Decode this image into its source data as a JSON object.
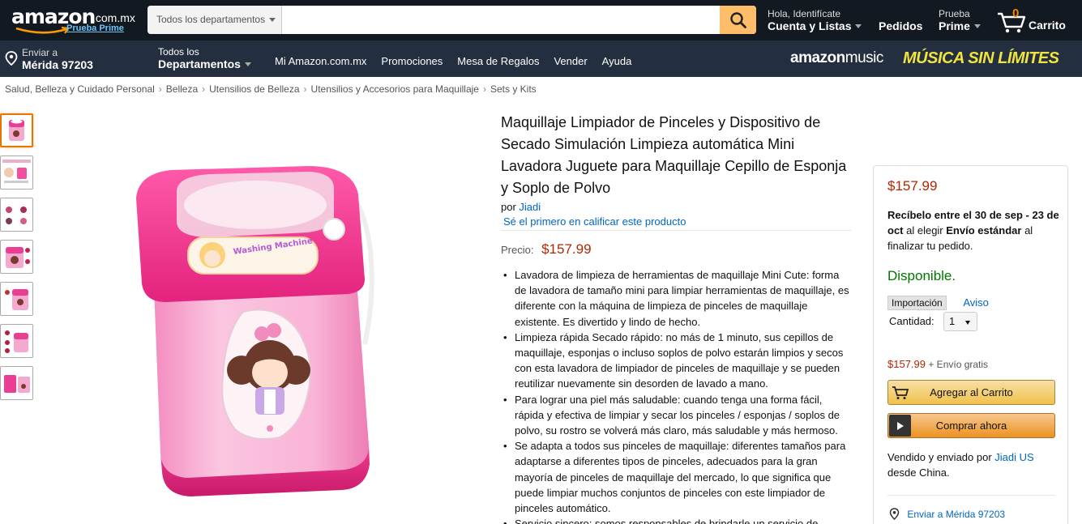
{
  "header": {
    "logo_text": "amazon",
    "logo_domain": ".com.mx",
    "logo_prime": "Prueba Prime",
    "search_dept": "Todos los departamentos",
    "search_placeholder": "",
    "account_small": "Hola, Identifícate",
    "account_big": "Cuenta y Listas",
    "orders": "Pedidos",
    "prime_small": "Prueba",
    "prime_big": "Prime",
    "cart_count": "0",
    "cart_label": "Carrito"
  },
  "subnav": {
    "deliver_small": "Enviar a",
    "deliver_big": "Mérida 97203",
    "departments_small": "Todos los",
    "departments_big": "Departamentos",
    "links": [
      "Mi Amazon.com.mx",
      "Promociones",
      "Mesa de Regalos",
      "Vender",
      "Ayuda"
    ],
    "promo_brand_1": "amazon",
    "promo_brand_2": "music",
    "promo_slogan": "MÚSICA SIN LÍMITES"
  },
  "breadcrumb": [
    "Salud, Belleza y Cuidado Personal",
    "Belleza",
    "Utensilios de Belleza",
    "Utensilios y Accesorios para Maquillaje",
    "Sets y Kits"
  ],
  "breadcrumb_separator": "›",
  "product": {
    "title": "Maquillaje Limpiador de Pinceles y Dispositivo de Secado Simulación Limpieza automática Mini Lavadora Juguete para Maquillaje Cepillo de Esponja y Soplo de Polvo",
    "by_prefix": "por",
    "brand": "Jiadi",
    "rate_prompt": "Sé el primero en calificar este producto",
    "price_label": "Precio:",
    "price": "$157.99",
    "image_label": "Washing Machine",
    "thumbnail_count": 7,
    "selected_thumbnail": 1,
    "bullets": [
      "Lavadora de limpieza de herramientas de maquillaje Mini Cute: forma de lavadora de tamaño mini para limpiar herramientas de maquillaje, es diferente con la máquina de limpieza de pinceles de maquillaje existente. Es divertido y lindo de hecho.",
      "Limpieza rápida Secado rápido: no más de 1 minuto, sus cepillos de maquillaje, esponjas o incluso soplos de polvo estarán limpios y secos con esta lavadora de limpiador de pinceles de maquillaje y se pueden reutilizar nuevamente sin desorden de lavado a mano.",
      "Para lograr una piel más saludable: cuando tenga una forma fácil, rápida y efectiva de limpiar y secar los pinceles / esponjas / soplos de polvo, su rostro se volverá más claro, más saludable y más hermoso.",
      "Se adapta a todos sus pinceles de maquillaje: diferentes tamaños para adaptarse a diferentes tipos de pinceles, adecuados para la gran mayoría de pinceles de maquillaje del mercado, lo que significa que puede limpiar muchos conjuntos de pinceles con este limpiador de pinceles automático.",
      "Servicio sincero: somos responsables de brindarle un servicio de"
    ]
  },
  "buybox": {
    "price": "$157.99",
    "delivery_prefix": "Recíbelo entre el 30 de sep - 23 de oct",
    "delivery_mid": " al elegir ",
    "delivery_method": "Envío estándar",
    "delivery_suffix": " al finalizar tu pedido.",
    "availability": "Disponible.",
    "import_tag": "Importación",
    "import_link": "Aviso",
    "qty_label": "Cantidad:",
    "qty_value": "1",
    "ship_price": "$157.99",
    "ship_text": "+ Envío gratis",
    "add_to_cart": "Agregar al Carrito",
    "buy_now": "Comprar ahora",
    "sold_prefix": "Vendido y enviado por",
    "seller": "Jiadi US",
    "sold_suffix": "desde China.",
    "deliver_to": "Enviar a Mérida 97203"
  },
  "colors": {
    "nav_dark": "#131921",
    "nav_sub": "#232f3e",
    "search_button": "#febd69",
    "price": "#b12704",
    "link": "#0066c0",
    "available": "#007600",
    "cart_button": "#f0c14b",
    "buy_button": "#ed9220",
    "thumb_selected": "#e77600"
  }
}
